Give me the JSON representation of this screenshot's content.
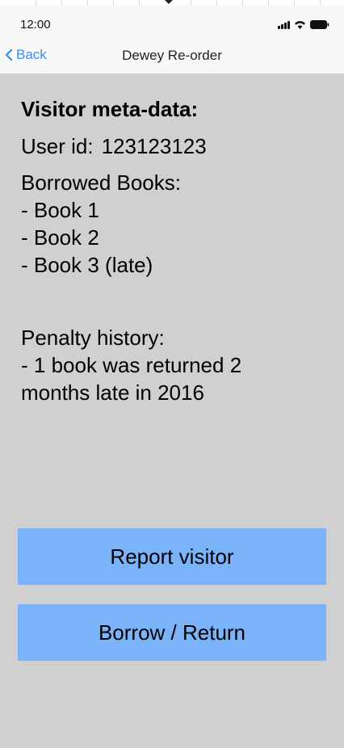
{
  "status_bar": {
    "time": "12:00",
    "signal_icon": "cellular-signal-icon",
    "wifi_icon": "wifi-icon",
    "battery_icon": "battery-icon"
  },
  "nav": {
    "back_label": "Back",
    "back_icon": "chevron-left-icon",
    "title": "Dewey Re-order",
    "accent_color": "#3d8ef0"
  },
  "visitor": {
    "heading": "Visitor meta-data:",
    "user_id_label": "User id:",
    "user_id_value": "123123123",
    "borrowed_heading": "Borrowed Books:",
    "borrowed_books": [
      "- Book 1",
      "- Book 2",
      "- Book 3 (late)"
    ],
    "penalty_heading": "Penalty history:",
    "penalty_lines": [
      "- 1 book was returned 2",
      "months late in 2016"
    ]
  },
  "actions": {
    "report_label": "Report visitor",
    "borrow_label": "Borrow / Return",
    "button_color": "#7ab3f7"
  }
}
